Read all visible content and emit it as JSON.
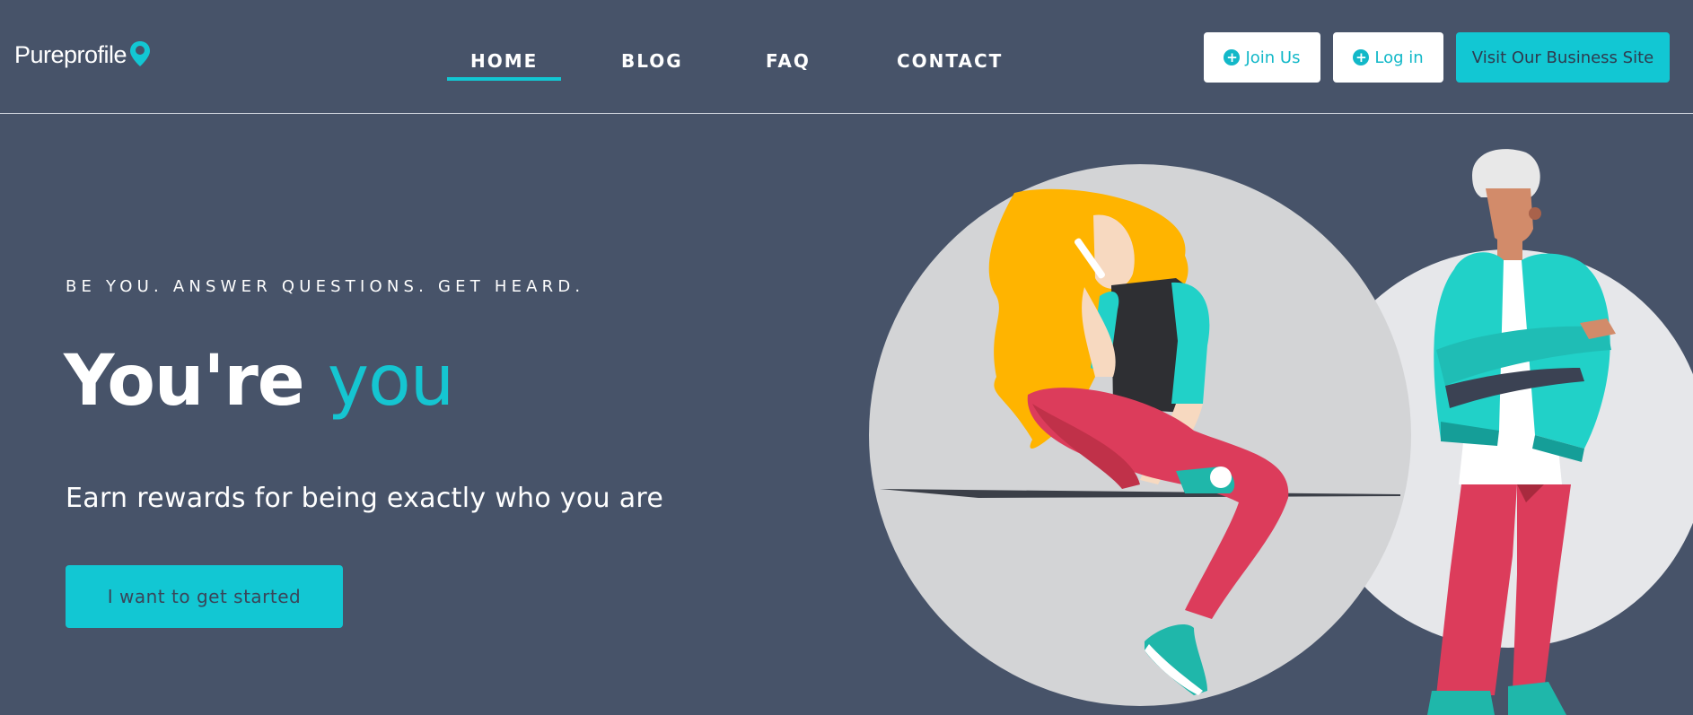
{
  "brand": {
    "name": "Pureprofile"
  },
  "nav": {
    "items": [
      {
        "label": "HOME",
        "active": true
      },
      {
        "label": "BLOG",
        "active": false
      },
      {
        "label": "FAQ",
        "active": false
      },
      {
        "label": "CONTACT",
        "active": false
      }
    ]
  },
  "header_actions": {
    "join_label": "Join Us",
    "login_label": "Log in",
    "business_label": "Visit Our Business Site",
    "plus_icon": "plus-circle-icon"
  },
  "hero": {
    "tagline": "BE YOU. ANSWER QUESTIONS. GET HEARD.",
    "headline_main": "You're",
    "headline_accent": "you",
    "subline": "Earn rewards for being exactly who you are",
    "cta_label": "I want to get started"
  },
  "colors": {
    "background": "#475369",
    "accent": "#12c7d3",
    "white": "#ffffff",
    "button_text_dark": "#3a4559"
  }
}
